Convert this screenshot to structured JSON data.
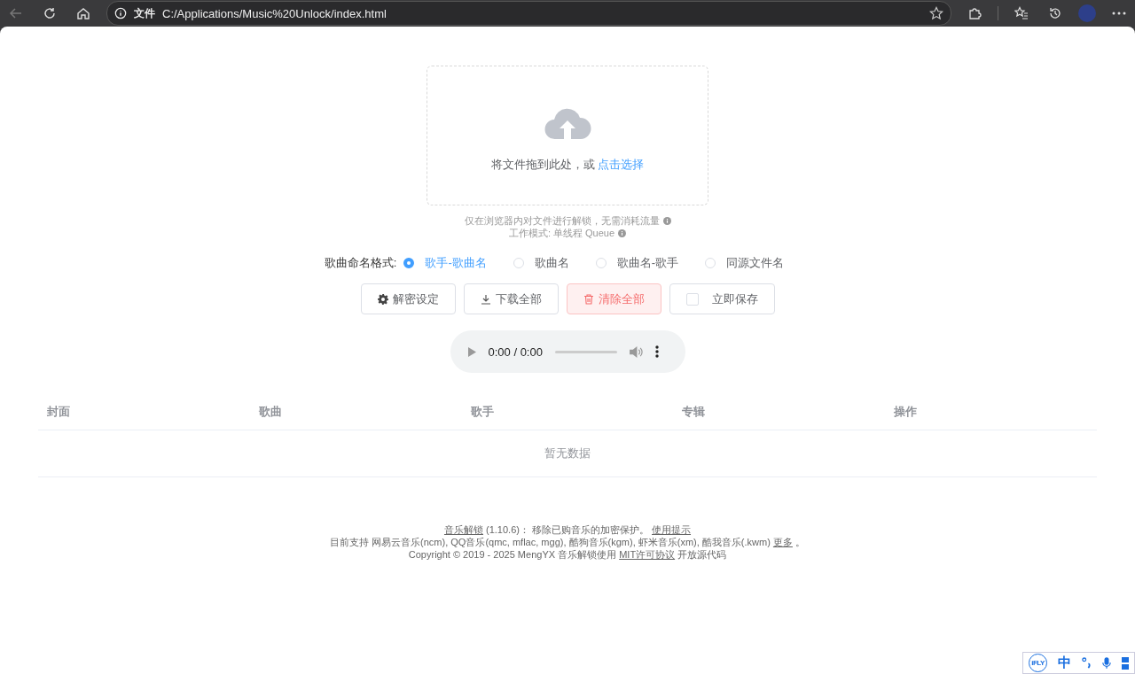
{
  "browser": {
    "site_label": "文件",
    "url": "C:/Applications/Music%20Unlock/index.html"
  },
  "upload": {
    "prompt": "将文件拖到此处，或",
    "link": "点击选择"
  },
  "notes": [
    "仅在浏览器内对文件进行解锁，无需消耗流量",
    "工作模式: 单线程 Queue"
  ],
  "naming": {
    "label": "歌曲命名格式:",
    "options": [
      {
        "label": "歌手-歌曲名",
        "selected": true
      },
      {
        "label": "歌曲名",
        "selected": false
      },
      {
        "label": "歌曲名-歌手",
        "selected": false
      },
      {
        "label": "同源文件名",
        "selected": false
      }
    ]
  },
  "actions": [
    {
      "kind": "settings",
      "label": "解密设定"
    },
    {
      "kind": "download",
      "label": "下载全部"
    },
    {
      "kind": "delete",
      "label": "清除全部"
    },
    {
      "kind": "checkbox",
      "label": "立即保存",
      "checked": false
    }
  ],
  "player": {
    "time": "0:00 / 0:00",
    "level": 0
  },
  "table": {
    "columns": [
      "封面",
      "歌曲",
      "歌手",
      "专辑",
      "操作"
    ],
    "empty": "暂无数据"
  },
  "footer": [
    [
      {
        "t": "音乐解锁",
        "link": true
      },
      {
        "t": " (1.10.6)： 移除已购音乐的加密保护。 ",
        "link": false
      },
      {
        "t": "使用提示",
        "link": true
      }
    ],
    [
      {
        "t": "目前支持 网易云音乐(ncm), QQ音乐(qmc, mflac, mgg), 酷狗音乐(kgm), 虾米音乐(xm), 酷我音乐(.kwm) ",
        "link": false
      },
      {
        "t": "更多",
        "link": true
      },
      {
        "t": " 。",
        "link": false
      }
    ],
    [
      {
        "t": "Copyright © 2019 - 2025 MengYX 音乐解锁使用 ",
        "link": false
      },
      {
        "t": "MIT许可协议",
        "link": true
      },
      {
        "t": " 开放源代码",
        "link": false
      }
    ]
  ],
  "ime": {
    "logo": "iFLY",
    "mode": "中"
  }
}
